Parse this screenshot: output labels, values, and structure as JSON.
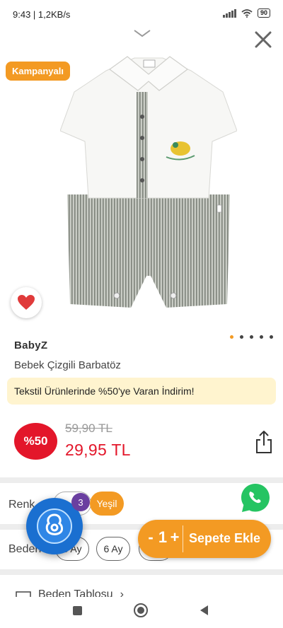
{
  "status_bar": {
    "time": "9:43 | 1,2KB/s",
    "battery": "90"
  },
  "product": {
    "badge": "Kampanyalı",
    "brand": "BabyZ",
    "name": "Bebek Çizgili Barbatöz",
    "promo": "Tekstil Ürünlerinde %50'ye Varan İndirim!",
    "discount": "%50",
    "old_price": "59,90 TL",
    "new_price": "29,95 TL",
    "image_count": 5,
    "active_image": 1
  },
  "options": {
    "color_label": "Renk",
    "color_selected": "Yeşil",
    "size_label": "Beden",
    "sizes": [
      "3 Ay",
      "6 Ay",
      "9 Ay"
    ]
  },
  "assistant": {
    "count": "3"
  },
  "cart": {
    "minus": "-",
    "quantity": "1",
    "plus": "+",
    "add_label": "Sepete Ekle"
  },
  "size_chart": {
    "label": "Beden Tablosu"
  },
  "icons": {
    "chevron": "chevron-down-icon",
    "close": "close-icon",
    "favorite": "heart-icon",
    "share": "share-icon",
    "whatsapp": "whatsapp-icon",
    "assistant": "accessibility-icon"
  },
  "colors": {
    "accent": "#f39a23",
    "price_red": "#e3162a",
    "promo_bg": "#fff4cf"
  }
}
